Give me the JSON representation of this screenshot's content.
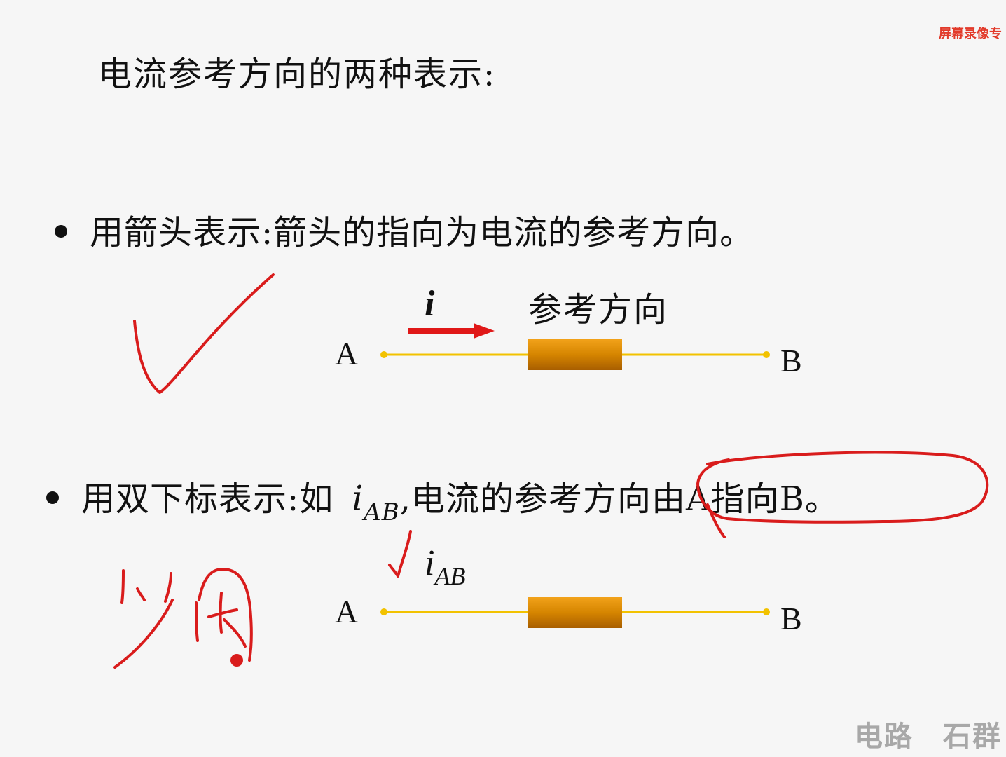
{
  "watermark": "屏幕录像专",
  "title": "电流参考方向的两种表示:",
  "bullet1": {
    "text": "用箭头表示:箭头的指向为电流的参考方向。"
  },
  "diagram1": {
    "current_symbol": "i",
    "ref_direction_label": "参考方向",
    "node_a": "A",
    "node_b": "B"
  },
  "bullet2": {
    "text_before": "用双下标表示:如",
    "symbol": "i",
    "subscript": "AB",
    "text_after": ",电流的参考方向由A指向B。"
  },
  "diagram2": {
    "current_symbol": "i",
    "subscript": "AB",
    "node_a": "A",
    "node_b": "B"
  },
  "footer": "电路　石群",
  "colors": {
    "wire": "#f2c200",
    "resistor": "#d48a00",
    "arrow": "#e01818",
    "ink": "#d91c1c"
  }
}
